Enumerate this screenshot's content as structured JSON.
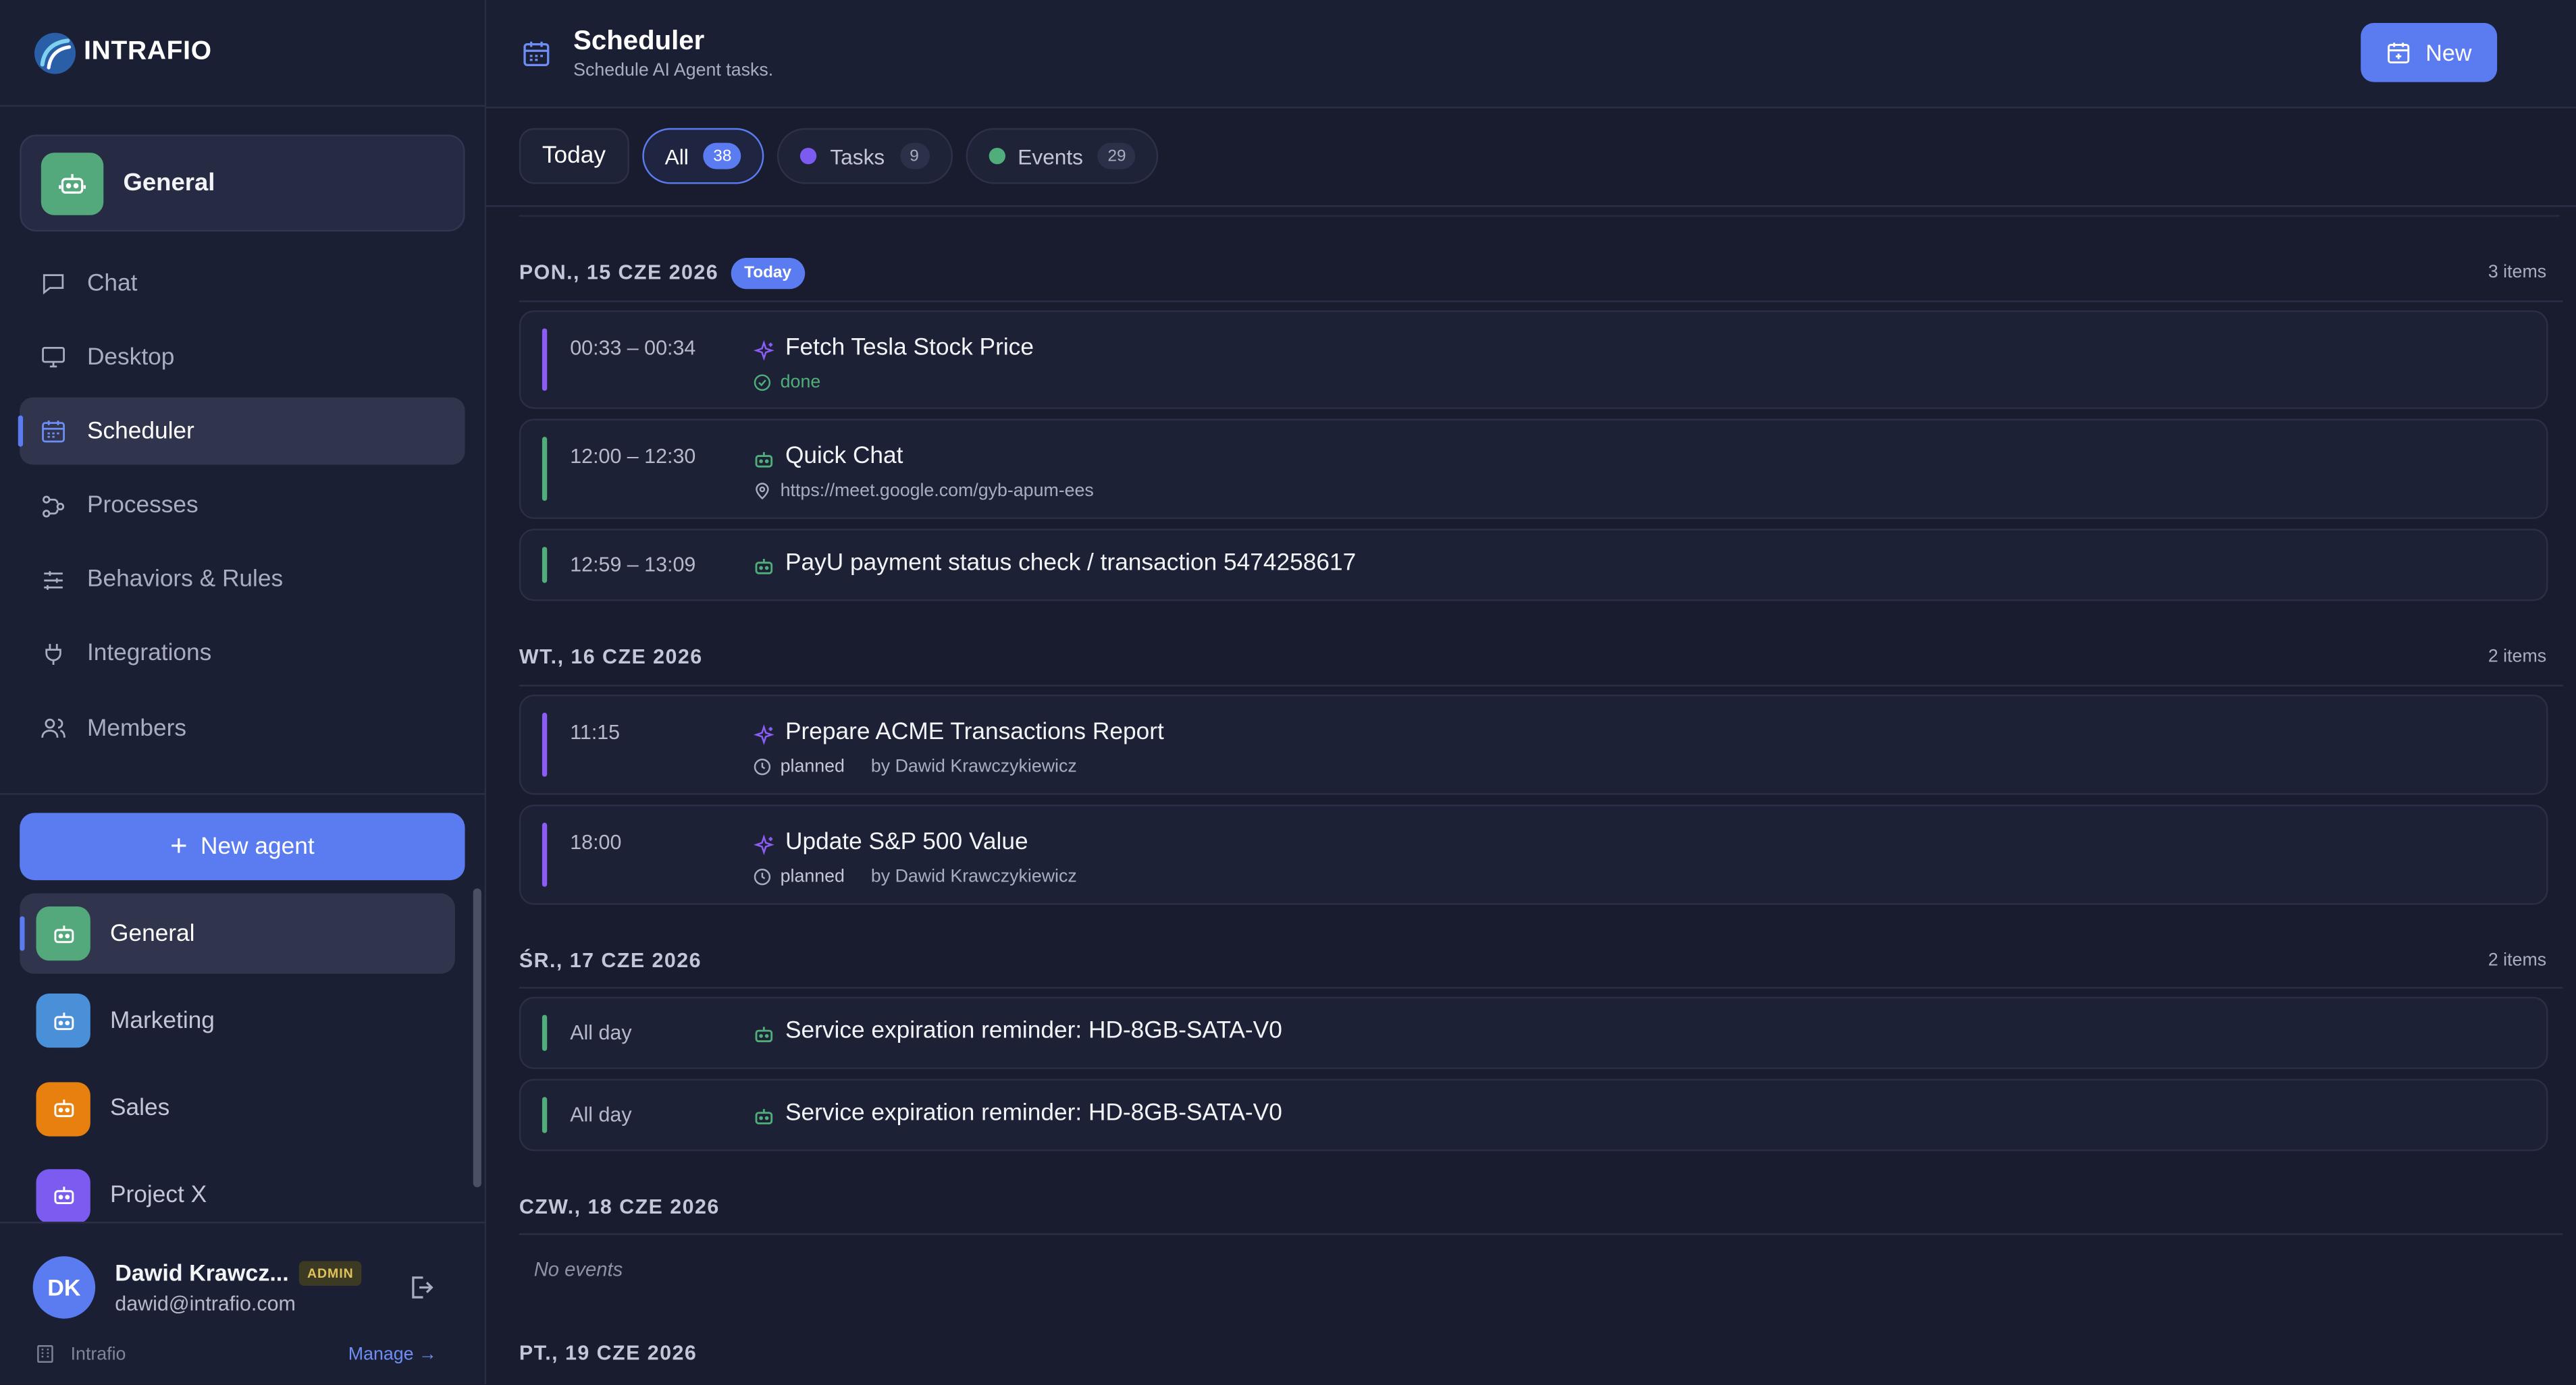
{
  "brand": {
    "name": "INTRAFIO"
  },
  "workspace": {
    "name": "General"
  },
  "nav": [
    {
      "label": "Chat",
      "icon": "chat-icon"
    },
    {
      "label": "Desktop",
      "icon": "desktop-icon"
    },
    {
      "label": "Scheduler",
      "icon": "calendar-icon",
      "active": true
    },
    {
      "label": "Processes",
      "icon": "processes-icon"
    },
    {
      "label": "Behaviors & Rules",
      "icon": "sliders-icon"
    },
    {
      "label": "Integrations",
      "icon": "plug-icon"
    },
    {
      "label": "Members",
      "icon": "users-icon"
    }
  ],
  "new_agent_label": "New agent",
  "agents": [
    {
      "name": "General",
      "color": "#54a97c",
      "active": true
    },
    {
      "name": "Marketing",
      "color": "#4a90d9"
    },
    {
      "name": "Sales",
      "color": "#e8800f"
    },
    {
      "name": "Project X",
      "color": "#7c5cf0"
    }
  ],
  "user": {
    "initials": "DK",
    "name": "Dawid Krawcz...",
    "badge": "ADMIN",
    "email": "dawid@intrafio.com",
    "org": "Intrafio",
    "manage": "Manage →"
  },
  "header": {
    "title": "Scheduler",
    "subtitle": "Schedule AI Agent tasks.",
    "new_label": "New"
  },
  "filters": {
    "today": "Today",
    "all": {
      "label": "All",
      "count": "38"
    },
    "tasks": {
      "label": "Tasks",
      "count": "9",
      "color": "#7c5cf0"
    },
    "events": {
      "label": "Events",
      "count": "29",
      "color": "#4fae7a"
    }
  },
  "colors": {
    "accent": "#5b7cf0",
    "task": "#8b5cf6",
    "event": "#4fae7a",
    "done": "#4fae7a"
  },
  "days": [
    {
      "label": "PON., 15 CZE 2026",
      "today_badge": "Today",
      "count": "3 items",
      "items": [
        {
          "time": "00:33 – 00:34",
          "title": "Fetch Tesla Stock Price",
          "kind": "task",
          "status": "done"
        },
        {
          "time": "12:00 – 12:30",
          "title": "Quick Chat",
          "kind": "event",
          "location": "https://meet.google.com/gyb-apum-ees"
        },
        {
          "time": "12:59 – 13:09",
          "title": "PayU payment status check / transaction 5474258617",
          "kind": "event"
        }
      ]
    },
    {
      "label": "WT., 16 CZE 2026",
      "count": "2 items",
      "items": [
        {
          "time": "11:15",
          "title": "Prepare ACME Transactions Report",
          "kind": "task",
          "status": "planned",
          "by": "by Dawid Krawczykiewicz"
        },
        {
          "time": "18:00",
          "title": "Update S&P 500 Value",
          "kind": "task",
          "status": "planned",
          "by": "by Dawid Krawczykiewicz"
        }
      ]
    },
    {
      "label": "ŚR., 17 CZE 2026",
      "count": "2 items",
      "items": [
        {
          "time": "All day",
          "title": "Service expiration reminder: HD-8GB-SATA-V0",
          "kind": "event"
        },
        {
          "time": "All day",
          "title": "Service expiration reminder: HD-8GB-SATA-V0",
          "kind": "event"
        }
      ]
    },
    {
      "label": "CZW., 18 CZE 2026",
      "empty_text": "No events",
      "items": []
    },
    {
      "label": "PT., 19 CZE 2026",
      "items": []
    }
  ]
}
